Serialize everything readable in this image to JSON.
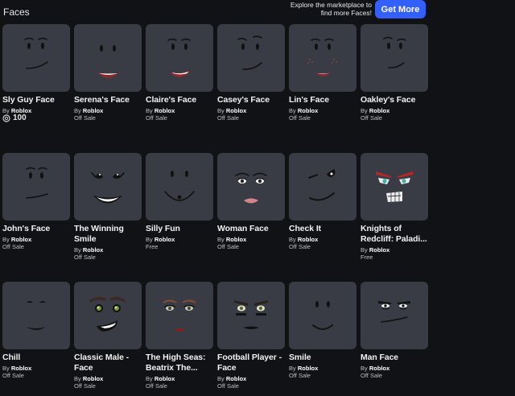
{
  "header": {
    "title": "Faces",
    "explore_text": "Explore the marketplace to find more Faces!",
    "get_more_label": "Get More"
  },
  "colors": {
    "accent": "#335fff",
    "background": "#111216",
    "card": "#393b45"
  },
  "items": [
    {
      "name": "Sly Guy Face",
      "by": "By",
      "creator": "Roblox",
      "price": "100",
      "price_type": "robux",
      "icon": "sly-guy-face-icon"
    },
    {
      "name": "Serena's Face",
      "by": "By",
      "creator": "Roblox",
      "price": "Off Sale",
      "price_type": "text",
      "icon": "serena-face-icon"
    },
    {
      "name": "Claire's Face",
      "by": "By",
      "creator": "Roblox",
      "price": "Off Sale",
      "price_type": "text",
      "icon": "claire-face-icon"
    },
    {
      "name": "Casey's Face",
      "by": "By",
      "creator": "Roblox",
      "price": "Off Sale",
      "price_type": "text",
      "icon": "casey-face-icon"
    },
    {
      "name": "Lin's Face",
      "by": "By",
      "creator": "Roblox",
      "price": "Off Sale",
      "price_type": "text",
      "icon": "lin-face-icon"
    },
    {
      "name": "Oakley's Face",
      "by": "By",
      "creator": "Roblox",
      "price": "Off Sale",
      "price_type": "text",
      "icon": "oakley-face-icon"
    },
    {
      "name": "John's Face",
      "by": "By",
      "creator": "Roblox",
      "price": "Off Sale",
      "price_type": "text",
      "icon": "john-face-icon"
    },
    {
      "name": "The Winning Smile",
      "by": "By",
      "creator": "Roblox",
      "price": "Off Sale",
      "price_type": "text",
      "icon": "winning-smile-icon"
    },
    {
      "name": "Silly Fun",
      "by": "By",
      "creator": "Roblox",
      "price": "Free",
      "price_type": "text",
      "icon": "silly-fun-icon"
    },
    {
      "name": "Woman Face",
      "by": "By",
      "creator": "Roblox",
      "price": "Off Sale",
      "price_type": "text",
      "icon": "woman-face-icon"
    },
    {
      "name": "Check It",
      "by": "By",
      "creator": "Roblox",
      "price": "Off Sale",
      "price_type": "text",
      "icon": "check-it-face-icon"
    },
    {
      "name": "Knights of Redcliff: Paladi...",
      "by": "By",
      "creator": "Roblox",
      "price": "Free",
      "price_type": "text",
      "icon": "knights-paladin-face-icon"
    },
    {
      "name": "Chill",
      "by": "By",
      "creator": "Roblox",
      "price": "Off Sale",
      "price_type": "text",
      "icon": "chill-face-icon"
    },
    {
      "name": "Classic Male - Face",
      "by": "By",
      "creator": "Roblox",
      "price": "Off Sale",
      "price_type": "text",
      "icon": "classic-male-face-icon"
    },
    {
      "name": "The High Seas: Beatrix The...",
      "by": "By",
      "creator": "Roblox",
      "price": "Off Sale",
      "price_type": "text",
      "icon": "beatrix-face-icon"
    },
    {
      "name": "Football Player - Face",
      "by": "By",
      "creator": "Roblox",
      "price": "Off Sale",
      "price_type": "text",
      "icon": "football-player-face-icon"
    },
    {
      "name": "Smile",
      "by": "By",
      "creator": "Roblox",
      "price": "Off Sale",
      "price_type": "text",
      "icon": "smile-face-icon"
    },
    {
      "name": "Man Face",
      "by": "By",
      "creator": "Roblox",
      "price": "Off Sale",
      "price_type": "text",
      "icon": "man-face-icon"
    }
  ]
}
